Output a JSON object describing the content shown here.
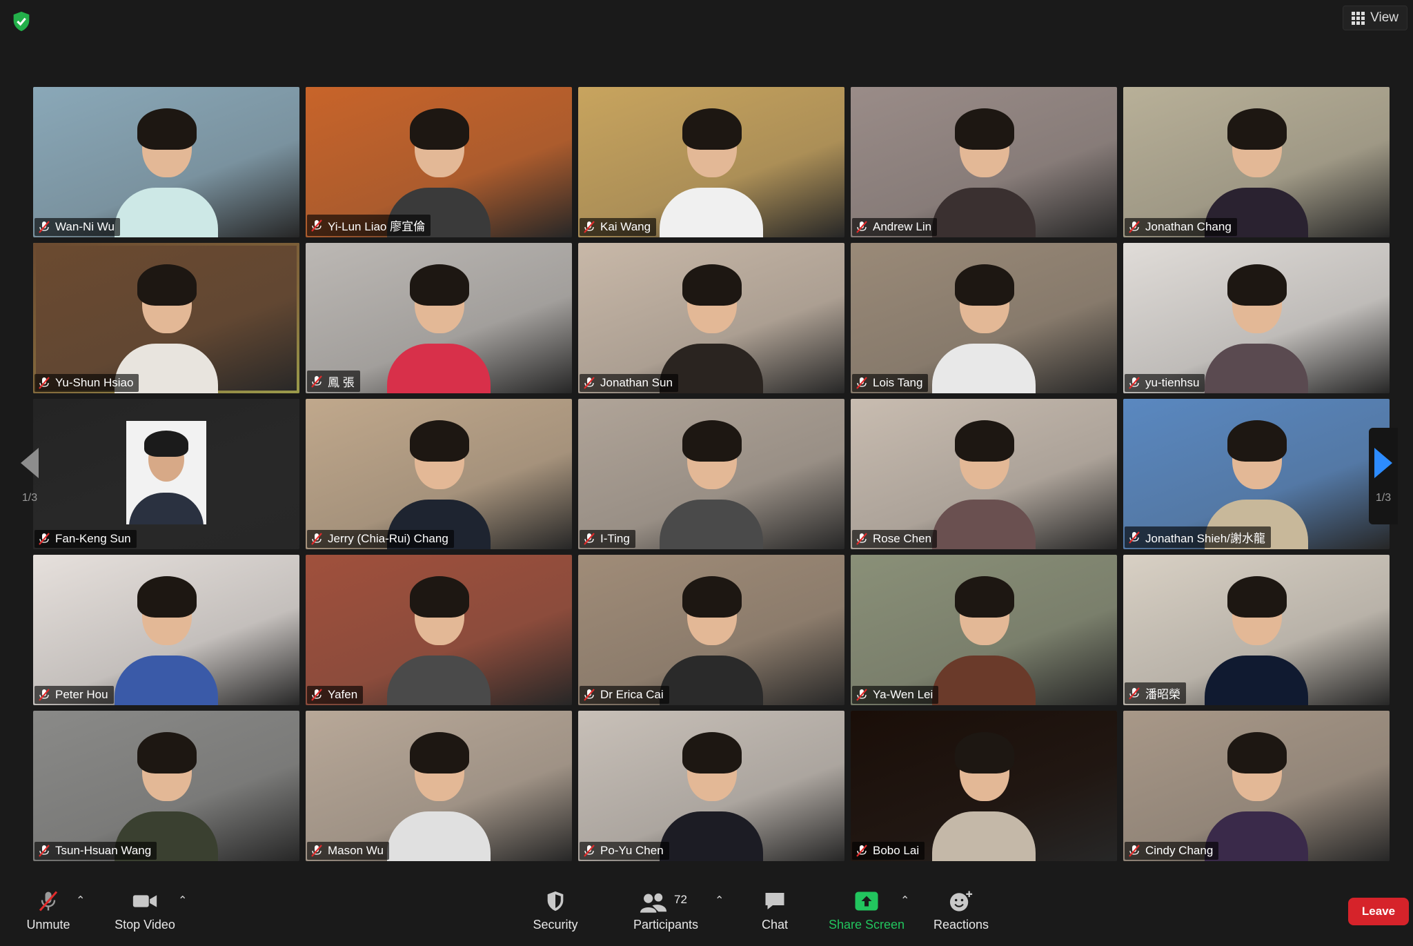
{
  "top_bar": {
    "view_label": "View"
  },
  "participants": [
    {
      "name": "Wan-Ni Wu",
      "bg": "#8aa8b8",
      "shirt": "#cde8e6"
    },
    {
      "name": "Yi-Lun Liao 廖宜倫",
      "bg": "#c8642a",
      "shirt": "#3a3a3a"
    },
    {
      "name": "Kai Wang",
      "bg": "#c8a45e",
      "shirt": "#f0f0f0"
    },
    {
      "name": "Andrew Lin",
      "bg": "#9a8c88",
      "shirt": "#3a3030"
    },
    {
      "name": "Jonathan Chang",
      "bg": "#b8b098",
      "shirt": "#2a2230"
    },
    {
      "name": "Yu-Shun Hsiao",
      "bg": "#6b4a30",
      "shirt": "#e8e4de",
      "active": true
    },
    {
      "name": "鳳 張",
      "bg": "#bcb8b4",
      "shirt": "#d8304a"
    },
    {
      "name": "Jonathan Sun",
      "bg": "#c8b8a8",
      "shirt": "#2a2420"
    },
    {
      "name": "Lois Tang",
      "bg": "#9a8a78",
      "shirt": "#e8e8e8"
    },
    {
      "name": "yu-tienhsu",
      "bg": "#e0dcd8",
      "shirt": "#5a4a50"
    },
    {
      "name": "Fan-Keng Sun",
      "bg": "#242424",
      "photo": true
    },
    {
      "name": "Jerry (Chia-Rui) Chang",
      "bg": "#c0a88c",
      "shirt": "#1e2430"
    },
    {
      "name": "I-Ting",
      "bg": "#b0a498",
      "shirt": "#4a4a4a"
    },
    {
      "name": "Rose Chen",
      "bg": "#c8bcb0",
      "shirt": "#6a5050"
    },
    {
      "name": "Jonathan Shieh/謝水龍",
      "bg": "#5a88c0",
      "shirt": "#c8b89a"
    },
    {
      "name": "Peter Hou",
      "bg": "#e6e0dc",
      "shirt": "#3a5aa8"
    },
    {
      "name": "Yafen",
      "bg": "#a0503c",
      "shirt": "#4a4a4a"
    },
    {
      "name": "Dr Erica Cai",
      "bg": "#a08c78",
      "shirt": "#2a2a2a"
    },
    {
      "name": "Ya-Wen Lei",
      "bg": "#8a9078",
      "shirt": "#6a3a2a"
    },
    {
      "name": "潘昭榮",
      "bg": "#d8d0c4",
      "shirt": "#101a30"
    },
    {
      "name": "Tsun-Hsuan Wang",
      "bg": "#8a8a88",
      "shirt": "#3a4030"
    },
    {
      "name": "Mason Wu",
      "bg": "#b8a898",
      "shirt": "#e0e0e0"
    },
    {
      "name": "Po-Yu Chen",
      "bg": "#c8c0b8",
      "shirt": "#1c1c24"
    },
    {
      "name": "Bobo Lai",
      "bg": "#1a0e08",
      "shirt": "#c4b8a8"
    },
    {
      "name": "Cindy Chang",
      "bg": "#a89888",
      "shirt": "#3a2a4a"
    }
  ],
  "pagination": {
    "left": "1/3",
    "right": "1/3"
  },
  "toolbar": {
    "unmute_label": "Unmute",
    "stop_video_label": "Stop Video",
    "security_label": "Security",
    "participants_label": "Participants",
    "participants_count": "72",
    "chat_label": "Chat",
    "share_screen_label": "Share Screen",
    "reactions_label": "Reactions",
    "leave_label": "Leave"
  },
  "colors": {
    "accent": "#2d8cff",
    "share": "#22c55e",
    "leave": "#d6232a",
    "active_border": "#e8e870"
  }
}
